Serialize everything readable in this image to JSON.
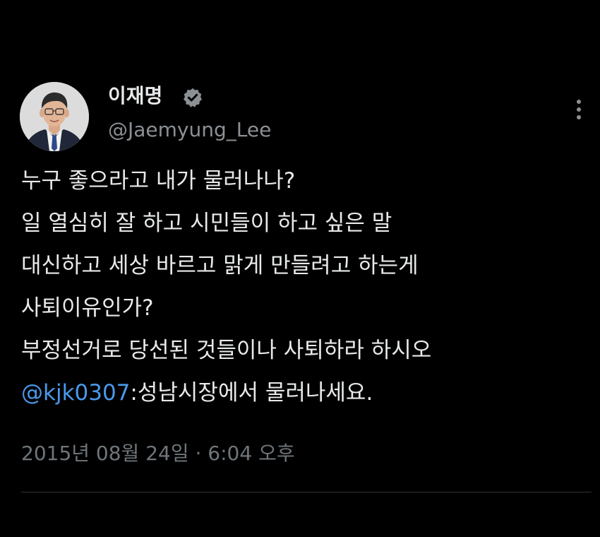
{
  "author": {
    "display_name": "이재명",
    "handle": "@Jaemyung_Lee",
    "verified": true,
    "verified_color": "#8b9095"
  },
  "tweet": {
    "lines": [
      "누구 좋으라고 내가 물러나나?",
      "일 열심히 잘 하고 시민들이 하고 싶은 말",
      "대신하고 세상 바르고 맑게 만들려고 하는게",
      "사퇴이유인가?",
      "부정선거로 당선된 것들이나 사퇴하라 하시오"
    ],
    "mention": "@kjk0307",
    "reply_text": ":성남시장에서 물러나세요.",
    "timestamp": "2015년 08월 24일 · 6:04 오후"
  },
  "colors": {
    "background": "#000000",
    "text": "#e7e9ea",
    "secondary": "#8b9095",
    "mention": "#4a99e9",
    "divider": "#2f3336"
  },
  "icons": {
    "verified": "verified-badge-icon",
    "more": "more-vertical-icon"
  }
}
